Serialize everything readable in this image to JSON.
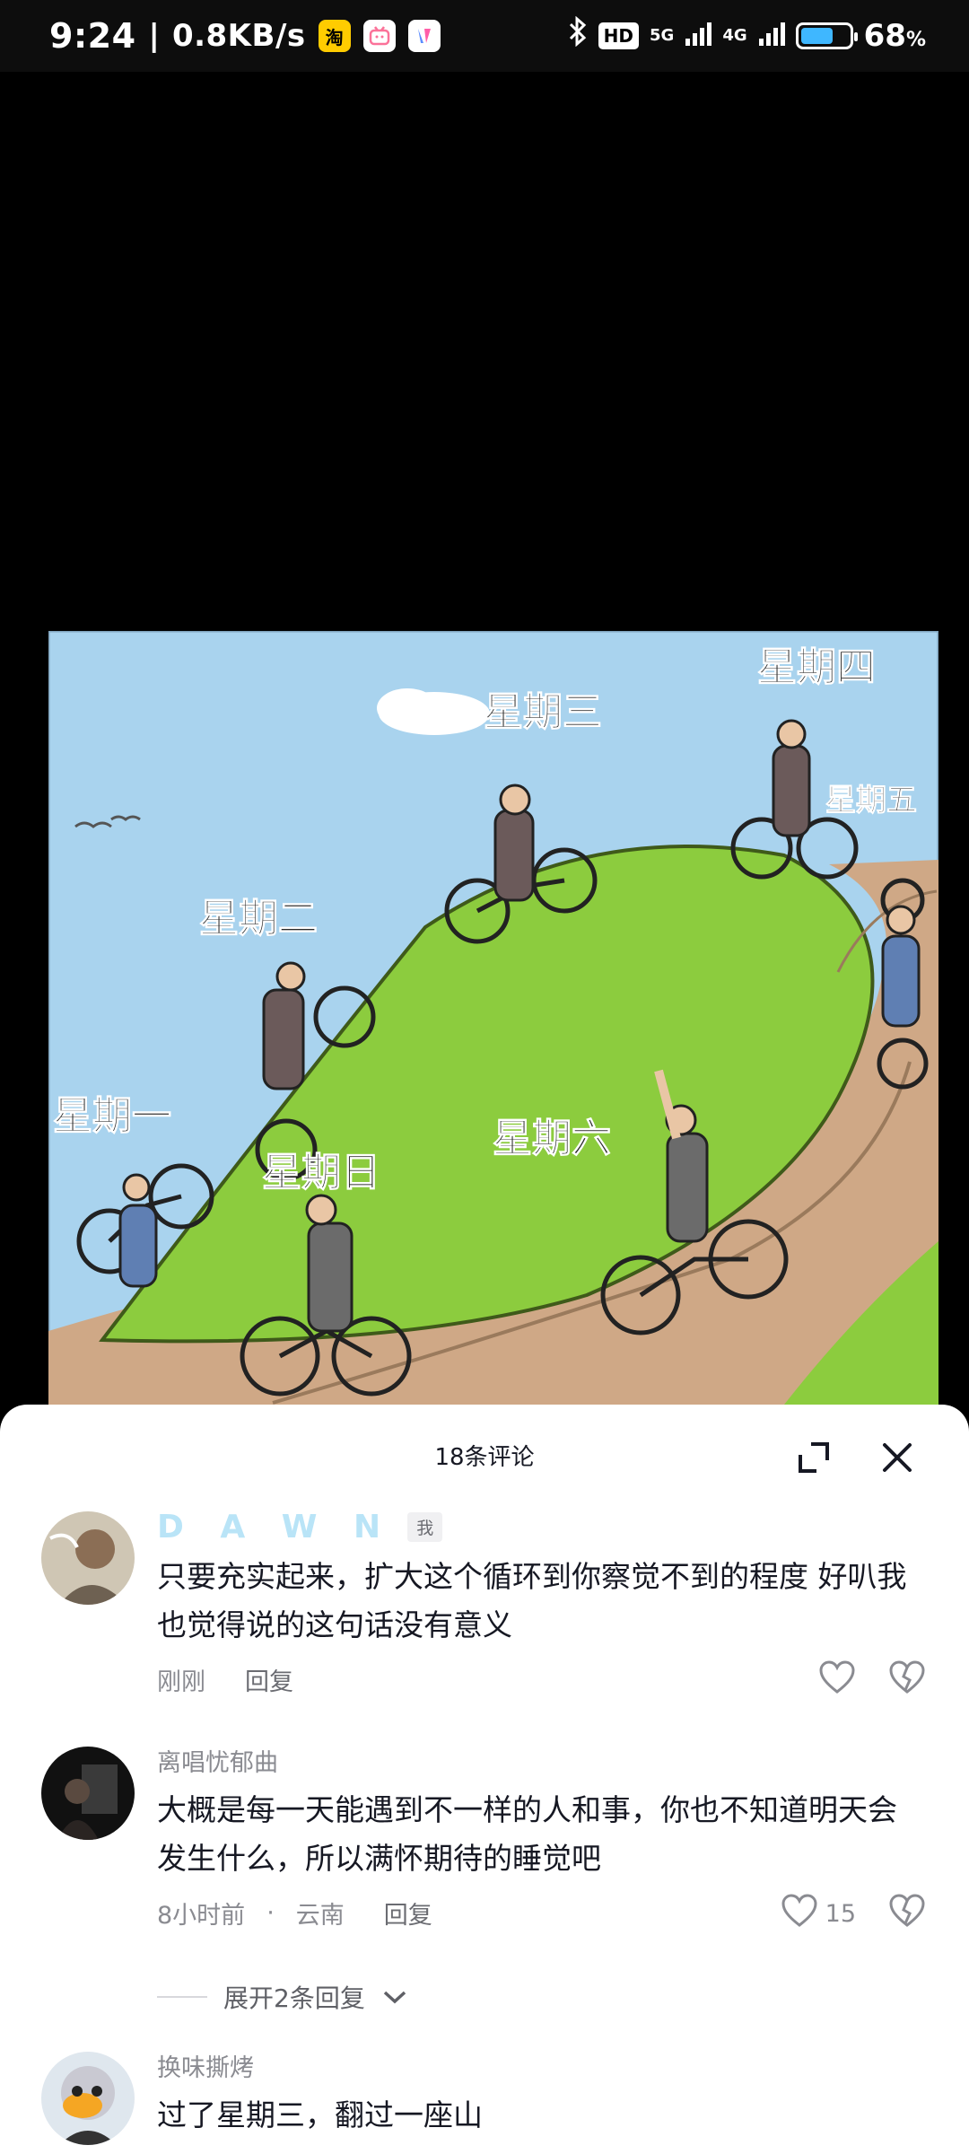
{
  "status_bar": {
    "time": "9:24",
    "net_speed": "0.8KB/s",
    "app_icons": [
      "taobao-icon",
      "bilibili-icon",
      "app-icon"
    ],
    "hd_label": "HD",
    "signal_5g": "5G",
    "signal_4g": "4G",
    "battery_percent": "68",
    "battery_unit": "%",
    "battery_level": 0.68
  },
  "illustration": {
    "labels": [
      "星期一",
      "星期二",
      "星期三",
      "星期四",
      "星期五",
      "星期六",
      "星期日"
    ]
  },
  "comments_panel": {
    "title": "18条评论",
    "comments": [
      {
        "username": "D A W N",
        "tag": "我",
        "text": "只要充实起来，扩大这个循环到你察觉不到的程度    好叭我也觉得说的这句话没有意义",
        "time": "刚刚",
        "reply_label": "回复",
        "likes": ""
      },
      {
        "username": "离唱忧郁曲",
        "text": "大概是每一天能遇到不一样的人和事，你也不知道明天会发生什么，所以满怀期待的睡觉吧",
        "time": "8小时前",
        "separator": "·",
        "location": "云南",
        "reply_label": "回复",
        "likes": "15",
        "expand_label": "展开2条回复"
      },
      {
        "username": "换味撕烤",
        "text": "过了星期三，翻过一座山"
      }
    ]
  },
  "colors": {
    "accent_username": "#b9e4f7",
    "sky": "#a9d3ee",
    "hill": "#8ccc3e",
    "battery": "#3fb7ff"
  }
}
